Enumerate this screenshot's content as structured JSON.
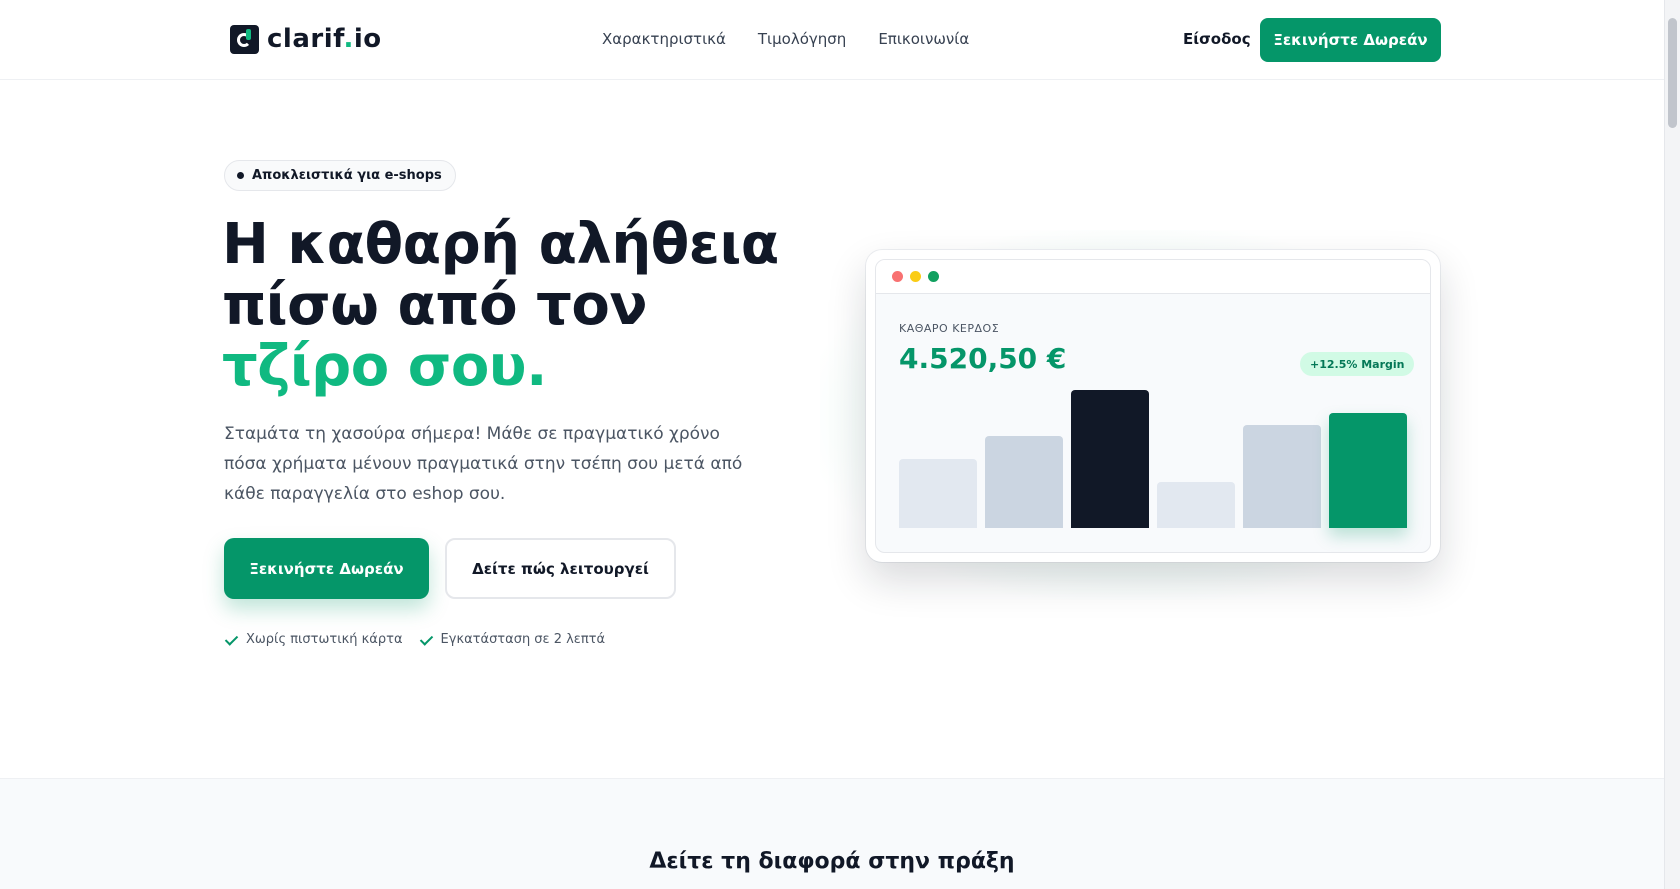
{
  "header": {
    "logo_text": "clarif",
    "logo_dot": ".",
    "logo_suffix": "io",
    "nav": [
      "Χαρακτηριστικά",
      "Τιμολόγηση",
      "Επικοινωνία"
    ],
    "login_label": "Είσοδος",
    "cta_label": "Ξεκινήστε Δωρεάν"
  },
  "hero": {
    "badge": "Αποκλειστικά για e-shops",
    "title_line1": "Η καθαρή αλήθεια",
    "title_line2": "πίσω από τον",
    "title_highlight": "τζίρο σου.",
    "subtitle": "Σταμάτα τη χασούρα σήμερα! Μάθε σε πραγματικό χρόνο πόσα χρήματα μένουν πραγματικά στην τσέπη σου μετά από κάθε παραγγελία στο eshop σου.",
    "primary_button": "Ξεκινήστε Δωρεάν",
    "secondary_button": "Δείτε πώς λειτουργεί",
    "perks": [
      "Χωρίς πιστωτική κάρτα",
      "Εγκατάσταση σε 2 λεπτά"
    ]
  },
  "dashboard": {
    "metric_label": "ΚΑΘΑΡΟ ΚΕΡΔΟΣ",
    "metric_value": "4.520,50 €",
    "margin_badge": "+12.5% Margin"
  },
  "chart_data": {
    "type": "bar",
    "values": [
      60,
      80,
      120,
      40,
      90,
      100
    ],
    "bar_colors": [
      "#e2e8f0",
      "#cbd5e1",
      "#111827",
      "#e2e8f0",
      "#cbd5e1",
      "#059669"
    ],
    "ylim": [
      0,
      120
    ]
  },
  "section2": {
    "title": "Δείτε τη διαφορά στην πράξη"
  },
  "colors": {
    "brand": "#059669",
    "accent": "#10b981",
    "dark": "#111827"
  }
}
